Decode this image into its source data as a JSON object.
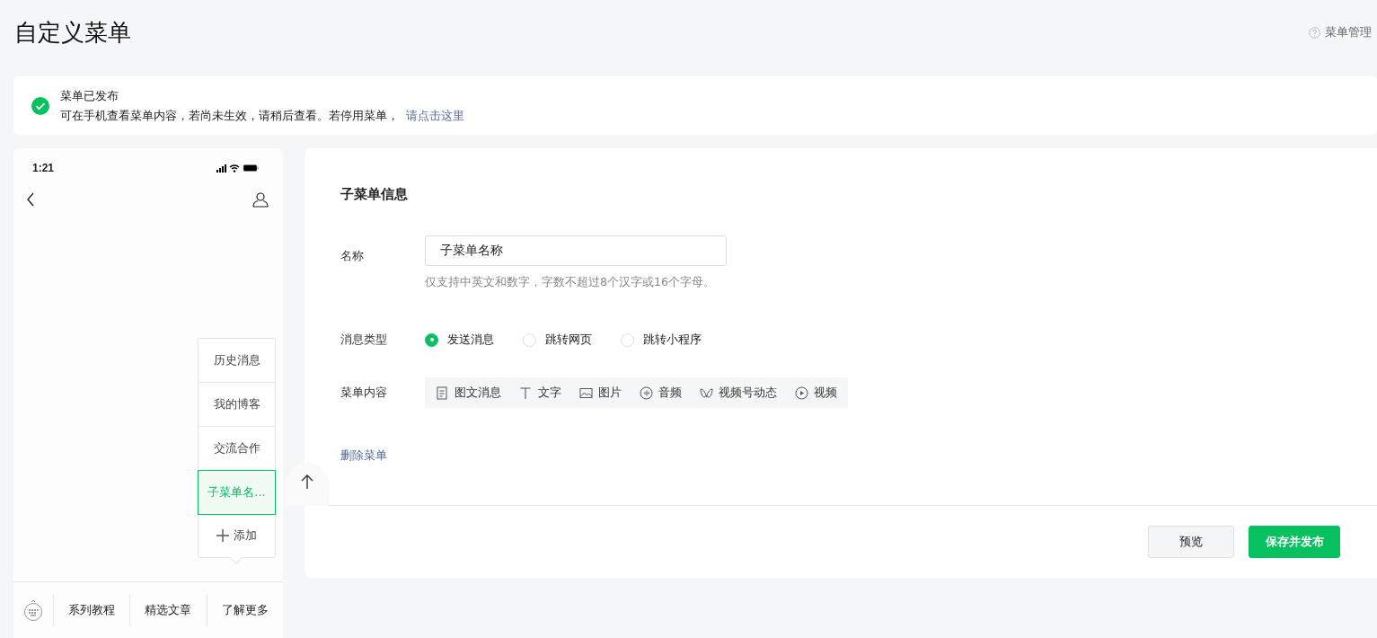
{
  "page_title": "自定义菜单",
  "help_link": "菜单管理",
  "notice": {
    "title": "菜单已发布",
    "text": "可在手机查看菜单内容，若尚未生效，请稍后查看。若停用菜单，",
    "link": "请点击这里"
  },
  "phone": {
    "time": "1:21",
    "submenu": [
      {
        "label": "历史消息",
        "selected": false
      },
      {
        "label": "我的博客",
        "selected": false
      },
      {
        "label": "交流合作",
        "selected": false
      },
      {
        "label": "子菜单名...",
        "selected": true
      }
    ],
    "add_label": "添加",
    "menu": [
      {
        "label": "系列教程"
      },
      {
        "label": "精选文章"
      },
      {
        "label": "了解更多"
      }
    ]
  },
  "form": {
    "section_title": "子菜单信息",
    "name_label": "名称",
    "name_value": "子菜单名称",
    "name_hint": "仅支持中英文和数字，字数不超过8个汉字或16个字母。",
    "type_label": "消息类型",
    "types": [
      {
        "label": "发送消息",
        "selected": true
      },
      {
        "label": "跳转网页",
        "selected": false
      },
      {
        "label": "跳转小程序",
        "selected": false
      }
    ],
    "content_label": "菜单内容",
    "content_tabs": [
      {
        "kind": "article",
        "label": "图文消息"
      },
      {
        "kind": "text",
        "label": "文字"
      },
      {
        "kind": "image",
        "label": "图片"
      },
      {
        "kind": "audio",
        "label": "音频"
      },
      {
        "kind": "channels",
        "label": "视频号动态"
      },
      {
        "kind": "video",
        "label": "视频"
      }
    ],
    "delete_link": "删除菜单",
    "buttons": [
      {
        "kind": "secondary",
        "label": "预览"
      },
      {
        "kind": "primary",
        "label": "保存并发布"
      }
    ]
  }
}
